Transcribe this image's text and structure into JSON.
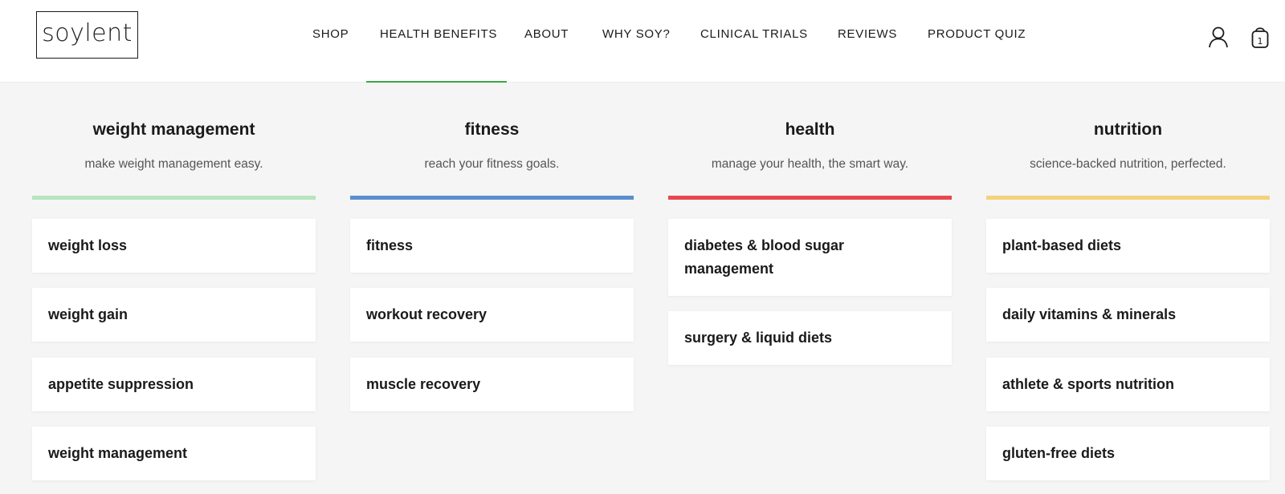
{
  "logo": {
    "text": "soylent"
  },
  "nav": {
    "items": [
      "SHOP",
      "HEALTH BENEFITS",
      "ABOUT",
      "WHY SOY?",
      "CLINICAL TRIALS",
      "REVIEWS",
      "PRODUCT QUIZ"
    ],
    "active": "HEALTH BENEFITS",
    "active_color": "#3aa843"
  },
  "cart": {
    "count": "1"
  },
  "columns": [
    {
      "title": "weight management",
      "subtitle": "make weight management easy.",
      "color": "#b4e6bf",
      "items": [
        "weight loss",
        "weight gain",
        "appetite suppression",
        "weight management"
      ]
    },
    {
      "title": "fitness",
      "subtitle": "reach your fitness goals.",
      "color": "#5a8fd0",
      "items": [
        "fitness",
        "workout recovery",
        "muscle recovery"
      ]
    },
    {
      "title": "health",
      "subtitle": "manage your health, the smart way.",
      "color": "#e8474f",
      "items": [
        "diabetes & blood sugar management",
        "surgery & liquid diets"
      ]
    },
    {
      "title": "nutrition",
      "subtitle": "science-backed nutrition, perfected.",
      "color": "#f2d27c",
      "items": [
        "plant-based diets",
        "daily vitamins & minerals",
        "athlete & sports nutrition",
        "gluten-free diets"
      ]
    }
  ]
}
